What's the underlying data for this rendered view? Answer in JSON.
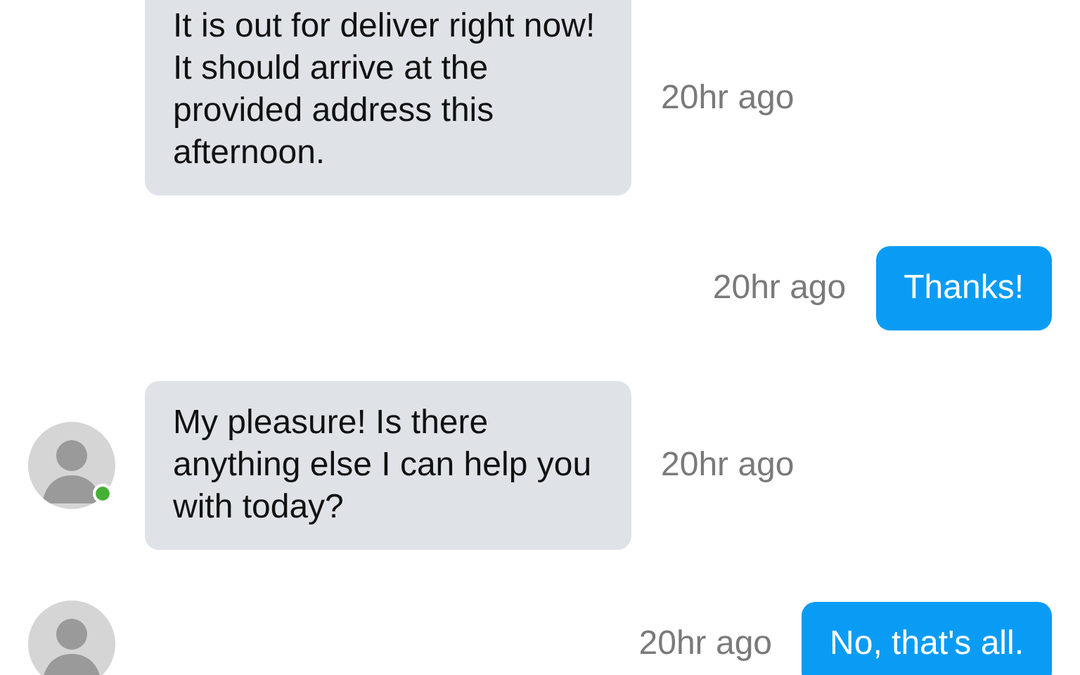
{
  "messages": [
    {
      "kind": "incoming",
      "text": "It is out for deliver right now! It should arrive at the provided address this afternoon.",
      "time": "20hr ago"
    },
    {
      "kind": "outgoing",
      "text": "Thanks!",
      "time": "20hr ago"
    },
    {
      "kind": "incoming",
      "text": "My pleasure! Is there anything else I can help you with today?",
      "time": "20hr ago",
      "avatar": true,
      "online": true
    },
    {
      "kind": "outgoing",
      "text": "No, that's all.",
      "time": "20hr ago"
    }
  ],
  "typing_avatar": true
}
